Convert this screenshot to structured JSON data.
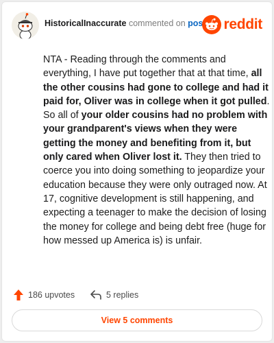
{
  "header": {
    "username": "HistoricalInaccurate",
    "action": "commented on",
    "post_link": "post",
    "logo_text": "reddit"
  },
  "comment": {
    "paragraph": [
      {
        "text": "NTA - Reading through the comments and everything, I have put together that at that time, ",
        "bold": false
      },
      {
        "text": "all the other cousins had gone to college and had it paid for, Oliver was in college when it got pulled",
        "bold": true
      },
      {
        "text": ". So all of ",
        "bold": false
      },
      {
        "text": "your older cousins had no problem with your grandparent's views when they were getting the money and benefiting from it, but only cared when Oliver lost it.",
        "bold": true
      },
      {
        "text": " They then tried to coerce you into doing something to jeopardize your education because they were only outraged now. At 17, cognitive development is still happening, and expecting a teenager to make the decision of losing the money for college and being debt free (huge for how messed up America is) is unfair.",
        "bold": false
      }
    ]
  },
  "footer": {
    "upvotes": "186 upvotes",
    "replies": "5 replies",
    "view_comments": "View 5 comments"
  },
  "icons": {
    "upvote": "upvote-arrow-icon",
    "reply": "reply-arrow-icon",
    "logo": "reddit-snoo-icon",
    "avatar": "avatar-icon"
  },
  "colors": {
    "brand": "#ff4500",
    "link": "#0a66c2",
    "text": "#1c1c1c"
  }
}
